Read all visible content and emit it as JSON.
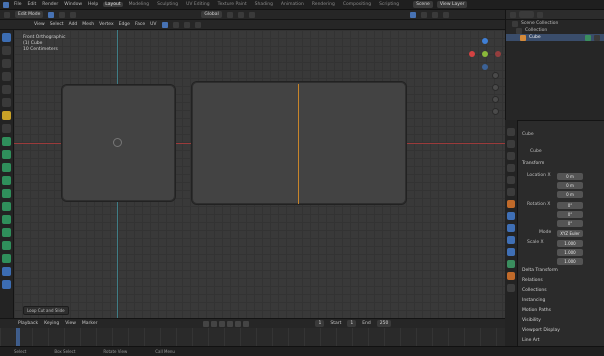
{
  "topbar": {
    "menus": [
      "File",
      "Edit",
      "Render",
      "Window",
      "Help"
    ],
    "workspaces": [
      "Layout",
      "Modeling",
      "Sculpting",
      "UV Editing",
      "Texture Paint",
      "Shading",
      "Animation",
      "Rendering",
      "Compositing",
      "Scripting"
    ],
    "scene": "Scene",
    "view_layer": "View Layer"
  },
  "header2": {
    "mode": "Edit Mode",
    "menus": [
      "View",
      "Select",
      "Add",
      "Mesh",
      "Vertex",
      "Edge",
      "Face",
      "UV"
    ],
    "transform": "Global"
  },
  "viewport": {
    "view_name": "Front Orthographic",
    "collection": "(1) Cube",
    "units": "10 Centimeters",
    "status_hint": "Loop Cut and Slide"
  },
  "outliner": {
    "title": "Scene Collection",
    "items": [
      "Collection",
      "Cube"
    ]
  },
  "properties": {
    "object_name": "Cube",
    "data_name": "Cube",
    "section": "Transform",
    "location_label": "Location X",
    "location": [
      "0 m",
      "0 m",
      "0 m"
    ],
    "rotation_label": "Rotation X",
    "rotation": [
      "0°",
      "0°",
      "0°"
    ],
    "mode_label": "Mode",
    "mode_value": "XYZ Euler",
    "scale_label": "Scale X",
    "scale": [
      "1.000",
      "1.000",
      "1.000"
    ],
    "subsections": [
      "Delta Transform",
      "Relations",
      "Collections",
      "Instancing",
      "Motion Paths",
      "Visibility",
      "Viewport Display",
      "Line Art"
    ]
  },
  "timeline": {
    "menus": [
      "Playback",
      "Keying",
      "View",
      "Marker"
    ],
    "start_label": "Start",
    "start": "1",
    "end_label": "End",
    "end": "250",
    "current": "1"
  },
  "statusbar": {
    "items": [
      "Select",
      "Box Select",
      "Rotate View",
      "Call Menu"
    ]
  },
  "colors": {
    "accent": "#4772b3",
    "x_axis": "#9b3b3b",
    "y_axis": "#3f7d86",
    "ortho_line": "#c8852a"
  }
}
